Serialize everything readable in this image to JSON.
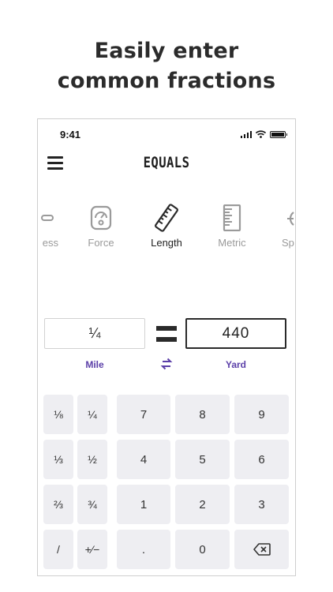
{
  "headline": {
    "line1": "Easily enter",
    "line2": "common fractions"
  },
  "status_bar": {
    "time": "9:41"
  },
  "header": {
    "app_title": "EQUALS"
  },
  "categories": [
    {
      "label": "ess",
      "icon": "partial-icon",
      "active": false
    },
    {
      "label": "Force",
      "icon": "scale-icon",
      "active": false
    },
    {
      "label": "Length",
      "icon": "ruler-icon",
      "active": true
    },
    {
      "label": "Metric",
      "icon": "metric-ruler-icon",
      "active": false
    },
    {
      "label": "Sp",
      "icon": "speed-icon",
      "active": false
    }
  ],
  "converter": {
    "from_value": "¼",
    "to_value": "440",
    "from_unit": "Mile",
    "to_unit": "Yard"
  },
  "keypad": {
    "fractions": [
      "⅛",
      "¼",
      "⅓",
      "½",
      "⅔",
      "¾",
      "/",
      "+⁄−"
    ],
    "digits": [
      "7",
      "8",
      "9",
      "4",
      "5",
      "6",
      "1",
      "2",
      "3",
      ".",
      "0"
    ]
  },
  "colors": {
    "accent": "#5b3fa8",
    "key_background": "#eeeef2"
  }
}
